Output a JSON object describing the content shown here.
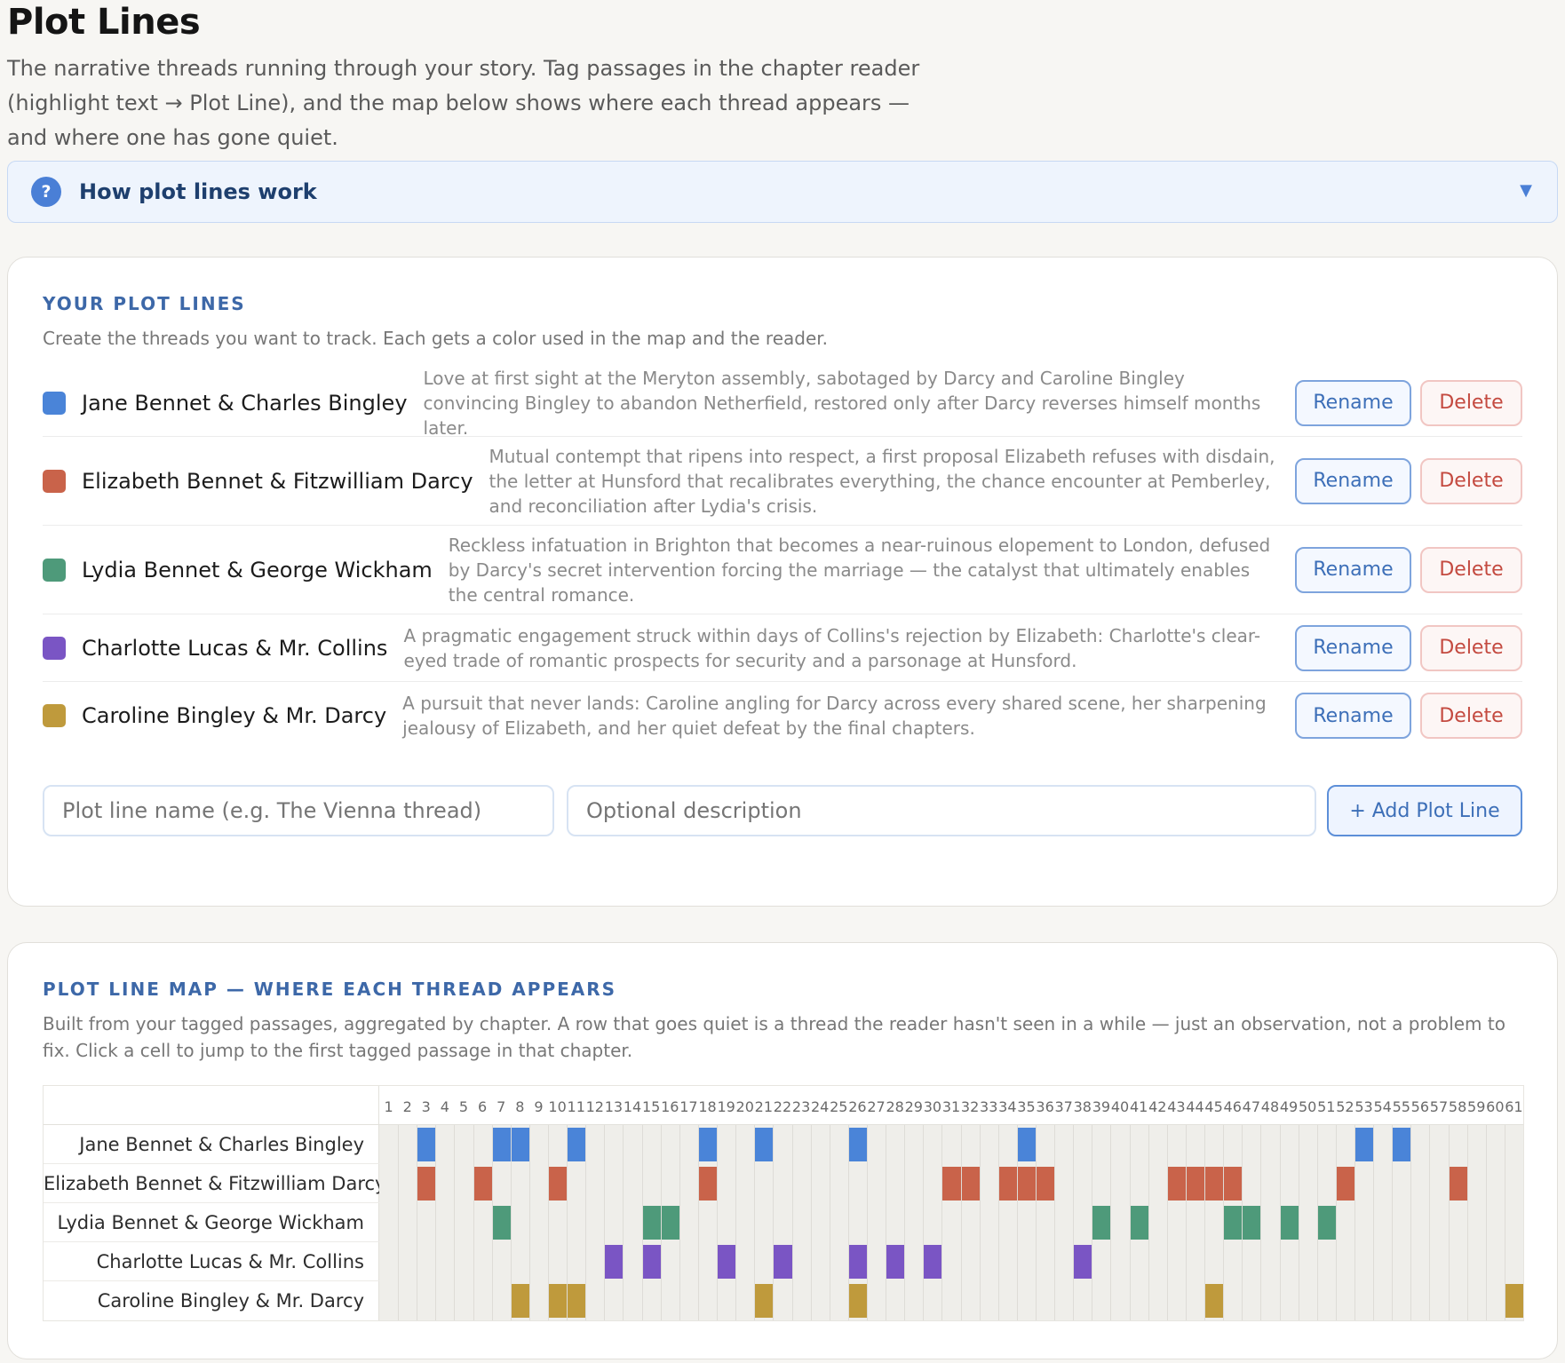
{
  "page": {
    "title": "Plot Lines",
    "subtitle": "The narrative threads running through your story. Tag passages in the chapter reader (highlight text → Plot Line), and the map below shows where each thread appears — and where one has gone quiet."
  },
  "help": {
    "icon": "?",
    "label": "How plot lines work",
    "chevron": "▼"
  },
  "your_plot_lines": {
    "title": "YOUR PLOT LINES",
    "description": "Create the threads you want to track. Each gets a color used in the map and the reader.",
    "rename_label": "Rename",
    "delete_label": "Delete",
    "items": [
      {
        "name": "Jane Bennet & Charles Bingley",
        "color": "#4a84d8",
        "description": "Love at first sight at the Meryton assembly, sabotaged by Darcy and Caroline Bingley convincing Bingley to abandon Netherfield, restored only after Darcy reverses himself months later."
      },
      {
        "name": "Elizabeth Bennet & Fitzwilliam Darcy",
        "color": "#c9634a",
        "description": "Mutual contempt that ripens into respect, a first proposal Elizabeth refuses with disdain, the letter at Hunsford that recalibrates everything, the chance encounter at Pemberley, and reconciliation after Lydia's crisis."
      },
      {
        "name": "Lydia Bennet & George Wickham",
        "color": "#4e9a7a",
        "description": "Reckless infatuation in Brighton that becomes a near-ruinous elopement to London, defused by Darcy's secret intervention forcing the marriage — the catalyst that ultimately enables the central romance."
      },
      {
        "name": "Charlotte Lucas & Mr. Collins",
        "color": "#7a55c4",
        "description": "A pragmatic engagement struck within days of Collins's rejection by Elizabeth: Charlotte's clear-eyed trade of romantic prospects for security and a parsonage at Hunsford."
      },
      {
        "name": "Caroline Bingley & Mr. Darcy",
        "color": "#bf9a3c",
        "description": "A pursuit that never lands: Caroline angling for Darcy across every shared scene, her sharpening jealousy of Elizabeth, and her quiet defeat by the final chapters."
      }
    ],
    "name_placeholder": "Plot line name (e.g. The Vienna thread)",
    "desc_placeholder": "Optional description",
    "add_label": "+ Add Plot Line"
  },
  "map": {
    "title": "PLOT LINE MAP — WHERE EACH THREAD APPEARS",
    "description": "Built from your tagged passages, aggregated by chapter. A row that goes quiet is a thread the reader hasn't seen in a while — just an observation, not a problem to fix. Click a cell to jump to the first tagged passage in that chapter.",
    "chapters": [
      1,
      2,
      3,
      4,
      5,
      6,
      7,
      8,
      9,
      10,
      11,
      12,
      13,
      14,
      15,
      16,
      17,
      18,
      19,
      20,
      21,
      22,
      23,
      24,
      25,
      26,
      27,
      28,
      29,
      30,
      31,
      32,
      33,
      34,
      35,
      36,
      37,
      38,
      39,
      40,
      41,
      42,
      43,
      44,
      45,
      46,
      47,
      48,
      49,
      50,
      51,
      52,
      53,
      54,
      55,
      56,
      57,
      58,
      59,
      60,
      61
    ],
    "rows": [
      {
        "name": "Jane Bennet & Charles Bingley",
        "chapters": [
          3,
          7,
          8,
          11,
          18,
          21,
          26,
          35,
          53,
          55
        ]
      },
      {
        "name": "Elizabeth Bennet & Fitzwilliam Darcy",
        "chapters": [
          3,
          6,
          10,
          18,
          31,
          32,
          34,
          35,
          36,
          43,
          44,
          45,
          46,
          52,
          58
        ]
      },
      {
        "name": "Lydia Bennet & George Wickham",
        "chapters": [
          7,
          15,
          16,
          39,
          41,
          46,
          47,
          49,
          51
        ]
      },
      {
        "name": "Charlotte Lucas & Mr. Collins",
        "chapters": [
          13,
          15,
          19,
          22,
          26,
          28,
          30,
          38
        ]
      },
      {
        "name": "Caroline Bingley & Mr. Darcy",
        "chapters": [
          8,
          10,
          11,
          21,
          26,
          45,
          61
        ]
      }
    ]
  }
}
